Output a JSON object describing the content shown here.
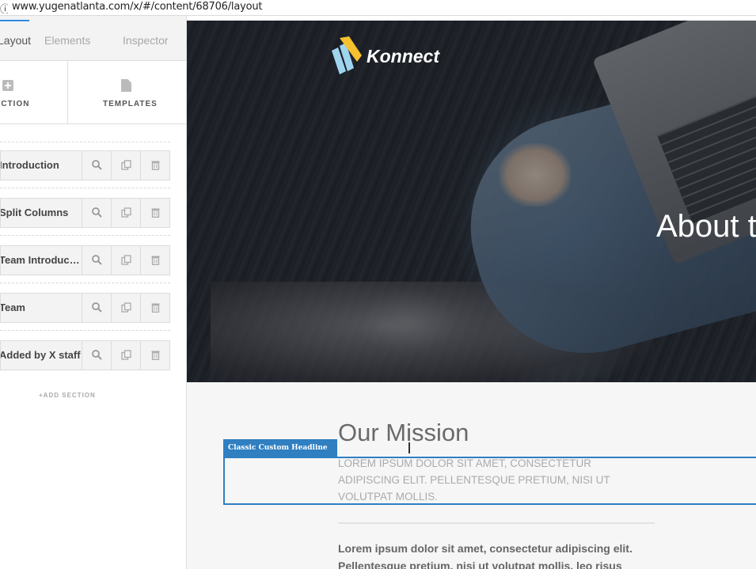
{
  "browser": {
    "url": "www.yugenatlanta.com/x/#/content/68706/layout",
    "info_icon": "info-icon"
  },
  "sidebar": {
    "tabs": [
      {
        "label": "Layout",
        "active": true
      },
      {
        "label": "Elements",
        "active": false
      },
      {
        "label": "Inspector",
        "active": false
      }
    ],
    "actions": {
      "section_label": "SECTION",
      "templates_label": "TEMPLATES"
    },
    "sections": [
      {
        "label": "Introduction"
      },
      {
        "label": "Split Columns"
      },
      {
        "label": "Team Introduc…"
      },
      {
        "label": "Team"
      },
      {
        "label": "Added by X staff"
      }
    ],
    "add_section": "+ADD SECTION",
    "icons": {
      "inspect": "search-icon",
      "duplicate": "copy-icon",
      "delete": "trash-icon"
    }
  },
  "hero": {
    "logo_text": "Konnect",
    "title": "About t"
  },
  "content": {
    "element_tag": "Classic Custom Headline",
    "headline": "Our Mission",
    "subheadline": "LOREM IPSUM DOLOR SIT AMET, CONSECTETUR ADIPISCING ELIT. PELLENTESQUE PRETIUM, NISI UT VOLUTPAT MOLLIS.",
    "paragraph": "Lorem ipsum dolor sit amet, consectetur adipiscing elit. Pellentesque pretium, nisi ut volutpat mollis, leo risus interdum arcu, eget facilisis"
  },
  "colors": {
    "accent": "#2f7fc1",
    "tab_underline": "#2e8be0",
    "logo_yellow": "#f6c02f",
    "logo_blue": "#9fd4ef"
  }
}
